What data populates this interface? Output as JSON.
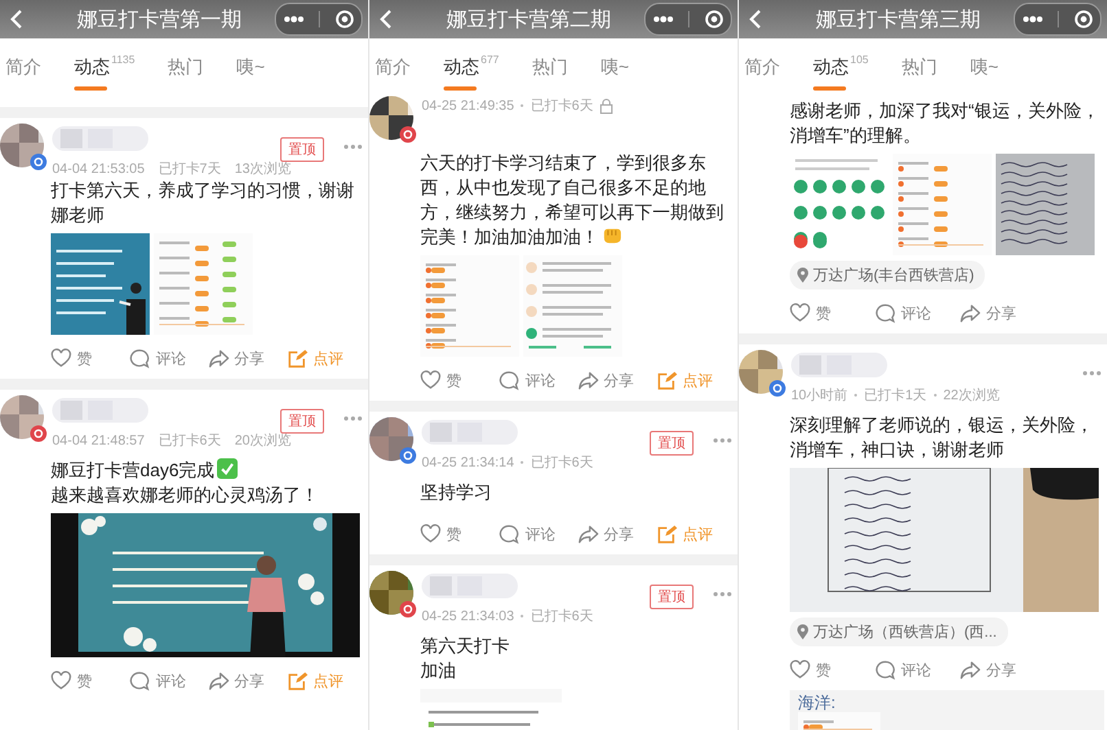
{
  "panels": [
    {
      "header": {
        "title": "娜豆打卡营第一期"
      },
      "tabs": [
        {
          "label": "简介",
          "selected": false
        },
        {
          "label": "动态",
          "count": "1135",
          "selected": true
        },
        {
          "label": "热门",
          "selected": false
        },
        {
          "label": "咦~",
          "selected": false
        }
      ],
      "posts": [
        {
          "author": {
            "badge": {
              "color": "#3d7be0"
            }
          },
          "meta": {
            "time": "04-04 21:53:05",
            "days": "已打卡7天",
            "views": "13次浏览"
          },
          "pinned": "置顶",
          "more": true,
          "paragraphs": [
            {
              "text": "打卡第六天，养成了学习的习惯，谢谢娜老师"
            }
          ],
          "images": [
            {
              "kind": "picture"
            },
            {
              "kind": "picture"
            }
          ],
          "actions": [
            {
              "kind": "like",
              "label": "赞"
            },
            {
              "kind": "comment",
              "label": "评论"
            },
            {
              "kind": "share",
              "label": "分享"
            },
            {
              "kind": "review",
              "label": "点评"
            }
          ]
        },
        {
          "author": {
            "badge": {
              "color": "#e0454b"
            }
          },
          "meta": {
            "time": "04-04 21:48:57",
            "days": "已打卡6天",
            "views": "20次浏览"
          },
          "pinned": "置顶",
          "more": true,
          "paragraphs": [
            {
              "text": "娜豆打卡营day6完成",
              "kind": "check"
            },
            {
              "text": "越来越喜欢娜老师的心灵鸡汤了！"
            }
          ],
          "images": [
            {
              "kind": "picture"
            }
          ],
          "actions": [
            {
              "kind": "like",
              "label": "赞"
            },
            {
              "kind": "comment",
              "label": "评论"
            },
            {
              "kind": "share",
              "label": "分享"
            },
            {
              "kind": "review",
              "label": "点评"
            }
          ]
        }
      ]
    },
    {
      "header": {
        "title": "娜豆打卡营第二期"
      },
      "tabs": [
        {
          "label": "简介",
          "selected": false
        },
        {
          "label": "动态",
          "count": "677",
          "selected": true
        },
        {
          "label": "热门",
          "selected": false
        },
        {
          "label": "咦~",
          "selected": false
        }
      ],
      "posts": [
        {
          "author": {
            "badge": {
              "color": "#e0454b"
            }
          },
          "meta": {
            "time": "04-25 21:49:35",
            "days": "已打卡6天",
            "locked": true
          },
          "paragraphs": [
            {
              "text": "六天的打卡学习结束了，学到很多东西，从中也发现了自己很多不足的地方，继续努力，希望可以再下一期做到完美！加油加油加油！",
              "kind": "fist"
            }
          ],
          "images": [
            {
              "kind": "picture"
            },
            {
              "kind": "picture"
            }
          ],
          "actions": [
            {
              "kind": "like",
              "label": "赞"
            },
            {
              "kind": "comment",
              "label": "评论"
            },
            {
              "kind": "share",
              "label": "分享"
            },
            {
              "kind": "review",
              "label": "点评"
            }
          ]
        },
        {
          "author": {
            "badge": {
              "color": "#3d7be0"
            }
          },
          "meta": {
            "time": "04-25 21:34:14",
            "days": "已打卡6天"
          },
          "pinned": "置顶",
          "more": true,
          "paragraphs": [
            {
              "text": "坚持学习"
            }
          ],
          "actions": [
            {
              "kind": "like",
              "label": "赞"
            },
            {
              "kind": "comment",
              "label": "评论"
            },
            {
              "kind": "share",
              "label": "分享"
            },
            {
              "kind": "review",
              "label": "点评"
            }
          ]
        },
        {
          "author": {
            "badge": {
              "color": "#e0454b"
            }
          },
          "meta": {
            "time": "04-25 21:34:03",
            "days": "已打卡6天"
          },
          "pinned": "置顶",
          "more": true,
          "paragraphs": [
            {
              "text": "第六天打卡"
            },
            {
              "text": "加油"
            }
          ],
          "images": [
            {
              "kind": "picture"
            }
          ]
        }
      ]
    },
    {
      "header": {
        "title": "娜豆打卡营第三期"
      },
      "tabs": [
        {
          "label": "简介",
          "selected": false
        },
        {
          "label": "动态",
          "count": "105",
          "selected": true
        },
        {
          "label": "热门",
          "selected": false
        },
        {
          "label": "咦~",
          "selected": false
        }
      ],
      "posts": [
        {
          "paragraphs": [
            {
              "text": "感谢老师，加深了我对“银运，关外险，消增车”的理解。"
            }
          ],
          "images": [
            {
              "kind": "picture"
            },
            {
              "kind": "picture"
            },
            {
              "kind": "picture"
            }
          ],
          "location": "万达广场(丰台西铁营店)",
          "actions": [
            {
              "kind": "like",
              "label": "赞"
            },
            {
              "kind": "comment",
              "label": "评论"
            },
            {
              "kind": "share",
              "label": "分享"
            }
          ]
        },
        {
          "author": {
            "badge": {
              "color": "#3d7be0"
            }
          },
          "meta": {
            "time": "10小时前",
            "days": "已打卡1天",
            "views": "22次浏览"
          },
          "more": true,
          "paragraphs": [
            {
              "text": "深刻理解了老师说的，银运，关外险，消增车，神口诀，谢谢老师"
            }
          ],
          "images": [
            {
              "kind": "picture"
            }
          ],
          "location": "万达广场（西铁营店）(西...",
          "actions": [
            {
              "kind": "like",
              "label": "赞"
            },
            {
              "kind": "comment",
              "label": "评论"
            },
            {
              "kind": "share",
              "label": "分享"
            }
          ],
          "comments": [
            {
              "author": "海洋:"
            }
          ]
        }
      ]
    }
  ]
}
